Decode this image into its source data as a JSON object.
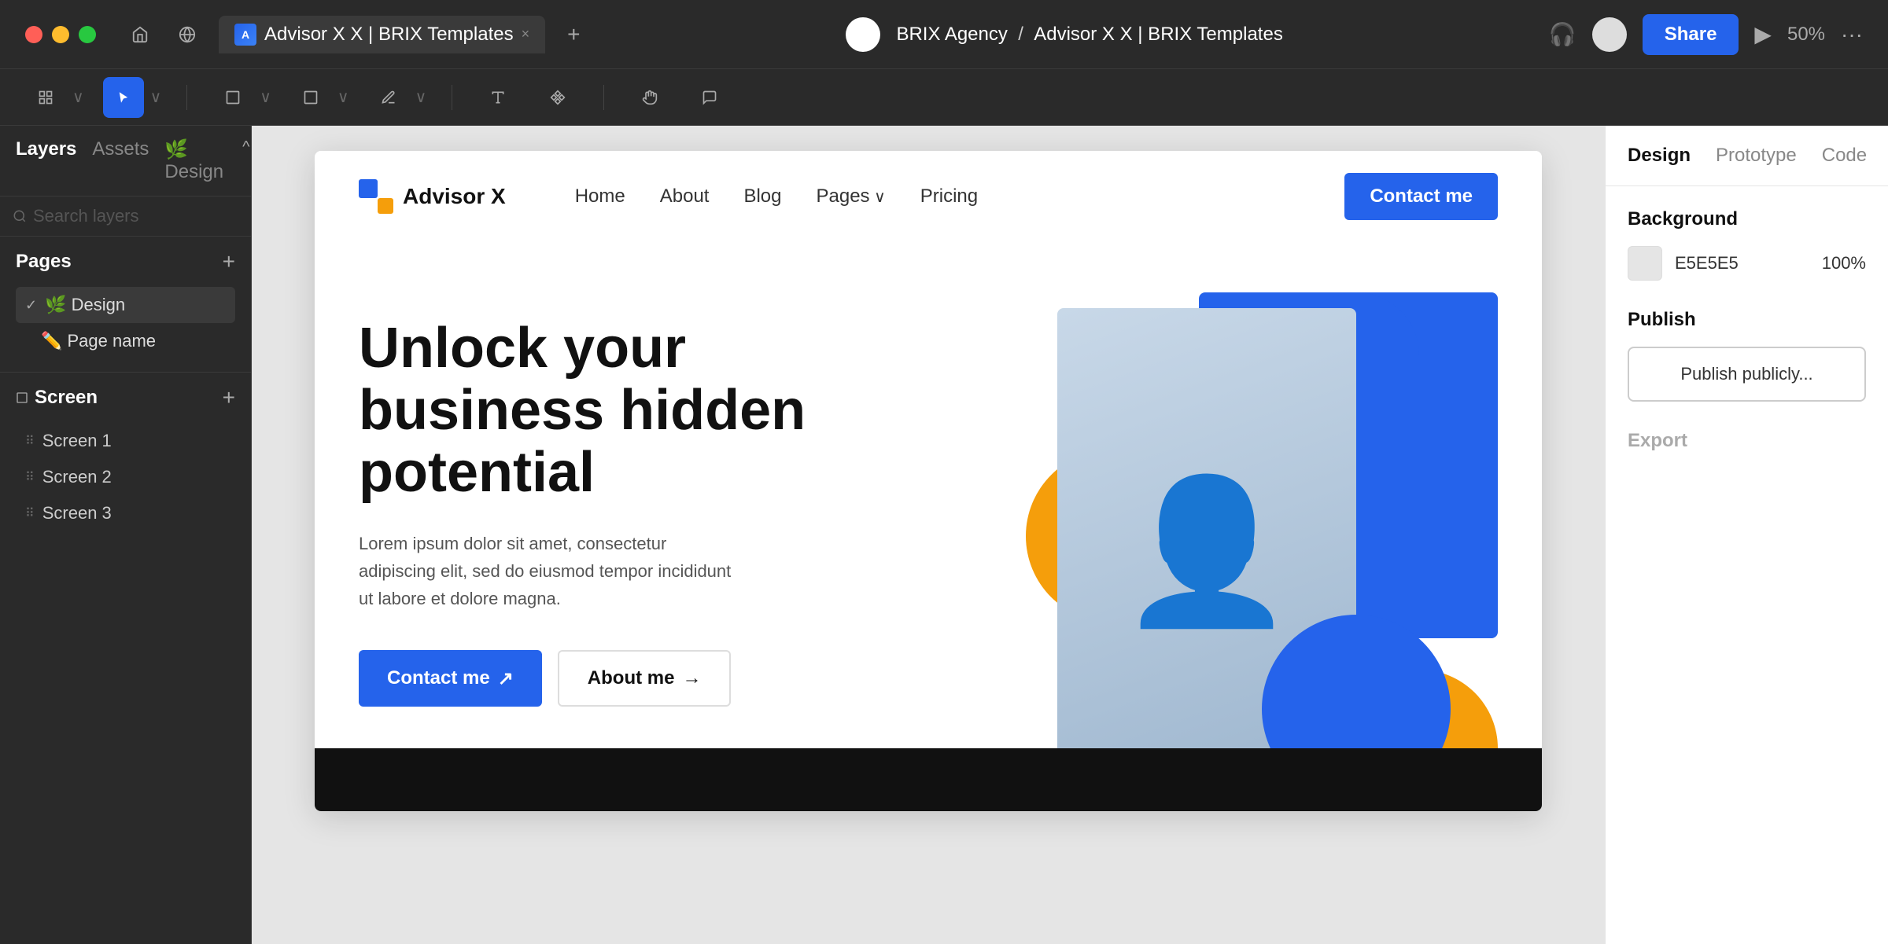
{
  "titlebar": {
    "tab_label": "Advisor X X | BRIX Templates",
    "breadcrumb_prefix": "BRIX Agency",
    "breadcrumb_separator": "/",
    "breadcrumb_current": "Advisor X X | BRIX Templates",
    "share_label": "Share",
    "zoom_label": "50%",
    "more_dots": "···"
  },
  "toolbar": {
    "tools": [
      "grid",
      "cursor",
      "frame",
      "shape",
      "pen",
      "text",
      "component",
      "hand",
      "comment"
    ]
  },
  "left_panel": {
    "tab_layers": "Layers",
    "tab_assets": "Assets",
    "tab_design": "🌿 Design",
    "pages_title": "Pages",
    "pages": [
      {
        "label": "🌿 Design",
        "active": true,
        "check": "✓"
      },
      {
        "label": "✏️ Page name",
        "active": false
      }
    ],
    "screen_title": "Screen",
    "screens": [
      {
        "label": "Screen 1"
      },
      {
        "label": "Screen 2"
      },
      {
        "label": "Screen 3"
      }
    ]
  },
  "website": {
    "logo_text": "Advisor X",
    "nav_links": [
      "Home",
      "About",
      "Blog",
      "Pages",
      "Pricing"
    ],
    "nav_pages_arrow": true,
    "nav_cta": "Contact me",
    "hero_title": "Unlock your business hidden potential",
    "hero_desc": "Lorem ipsum dolor sit amet, consectetur adipiscing elit, sed do eiusmod tempor incididunt ut labore et dolore magna.",
    "btn_contact": "Contact me ↗",
    "btn_about": "About me →"
  },
  "right_panel": {
    "tab_design": "Design",
    "tab_prototype": "Prototype",
    "tab_code": "Code",
    "background_title": "Background",
    "bg_value": "E5E5E5",
    "bg_opacity": "100%",
    "publish_title": "Publish",
    "publish_btn": "Publish publicly...",
    "export_title": "Export"
  }
}
